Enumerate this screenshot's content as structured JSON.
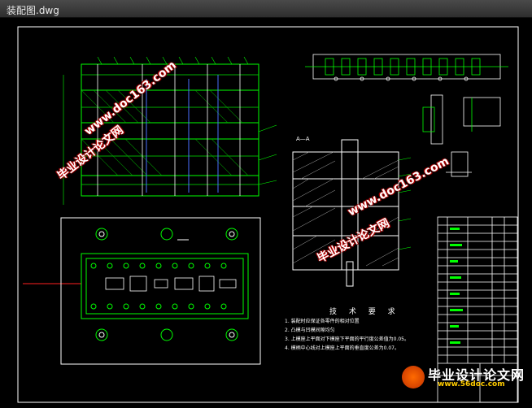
{
  "window": {
    "title": "装配图.dwg"
  },
  "drawing": {
    "section_label": "A—A",
    "tech_requirements_title": "技 术 要 求",
    "requirements": [
      "1. 装配时应保证各零件的相对位置",
      "2. 凸模与凹模间隙均匀",
      "3. 上模座上平面对下模座下平面的平行度公差值为0.05。",
      "4. 模柄中心线对上模座上平面的垂直度公差为0.07。"
    ]
  },
  "watermarks": {
    "wm1_line1": "毕业设计论文网",
    "wm1_line2": "www.doc163.com",
    "wm2_line1": "毕业设计论文网",
    "wm2_line2": "www.doc163.com"
  },
  "brand": {
    "name": "毕业设计论文网",
    "url": "www.56doc.com"
  },
  "colors": {
    "background": "#000000",
    "lines_primary": "#00ff00",
    "lines_secondary": "#ffffff",
    "accent_blue": "#4a6fff",
    "centerline_red": "#ff2020"
  }
}
